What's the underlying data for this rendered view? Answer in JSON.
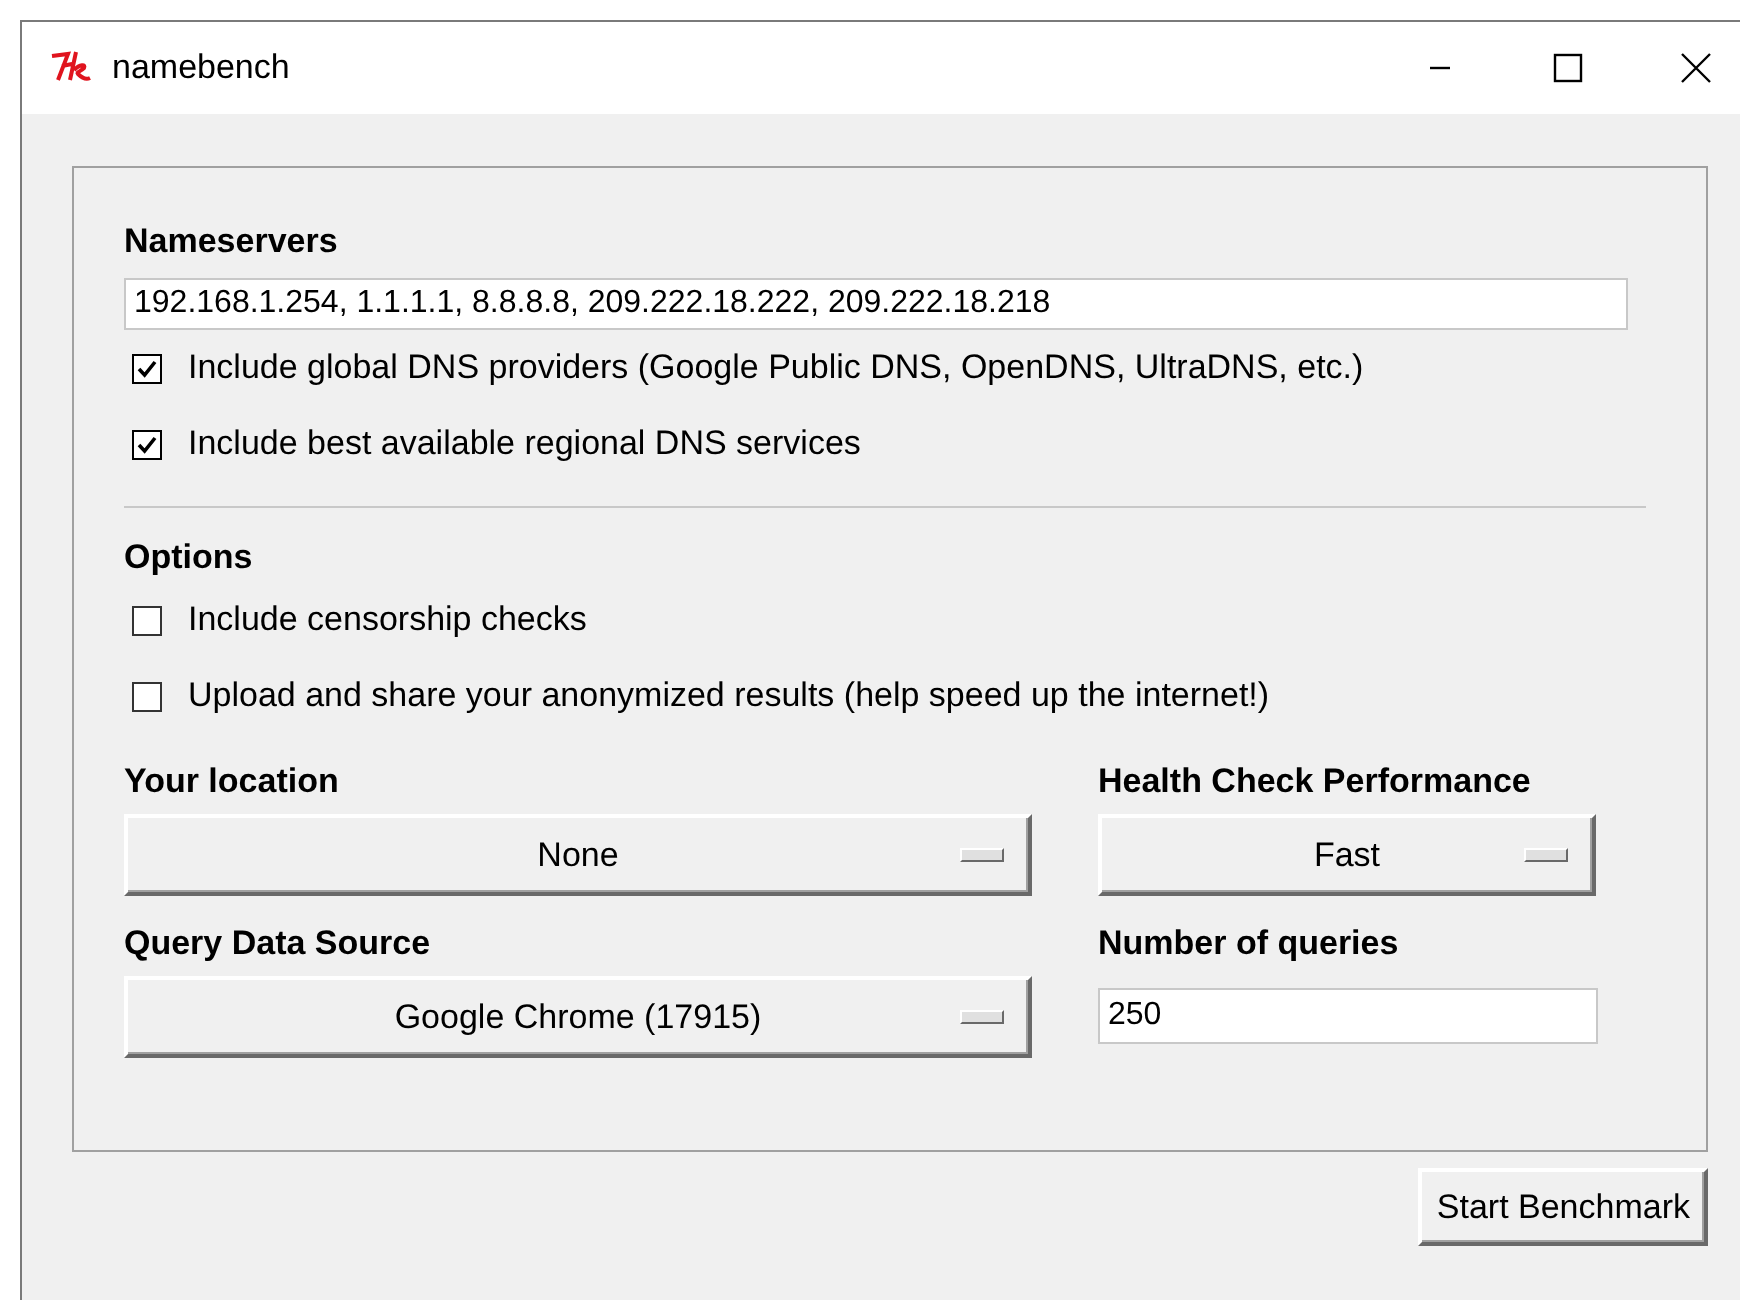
{
  "window": {
    "title": "namebench"
  },
  "nameservers": {
    "label": "Nameservers",
    "value": "192.168.1.254, 1.1.1.1, 8.8.8.8, 209.222.18.222, 209.222.18.218"
  },
  "nameserver_options": [
    {
      "label": "Include global DNS providers (Google Public DNS, OpenDNS, UltraDNS, etc.)",
      "checked": true
    },
    {
      "label": "Include best available regional DNS services",
      "checked": true
    }
  ],
  "options": {
    "label": "Options",
    "items": [
      {
        "label": "Include censorship checks",
        "checked": false
      },
      {
        "label": "Upload and share your anonymized results (help speed up the internet!)",
        "checked": false
      }
    ]
  },
  "location": {
    "label": "Your location",
    "value": "None"
  },
  "health_check": {
    "label": "Health Check Performance",
    "value": "Fast"
  },
  "query_source": {
    "label": "Query Data Source",
    "value": "Google Chrome (17915)"
  },
  "queries": {
    "label": "Number of queries",
    "value": "250"
  },
  "buttons": [
    "Start Benchmark"
  ]
}
